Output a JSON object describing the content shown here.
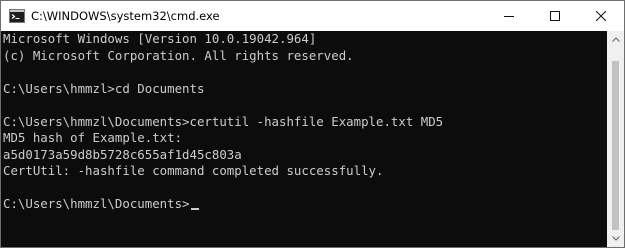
{
  "window": {
    "title": "C:\\WINDOWS\\system32\\cmd.exe",
    "icon": "cmd-app-icon"
  },
  "caption_buttons": {
    "minimize": "minimize-icon",
    "maximize": "maximize-icon",
    "close": "close-icon"
  },
  "console": {
    "lines": [
      "Microsoft Windows [Version 10.0.19042.964]",
      "(c) Microsoft Corporation. All rights reserved.",
      "",
      "C:\\Users\\hmmzl>cd Documents",
      "",
      "C:\\Users\\hmmzl\\Documents>certutil -hashfile Example.txt MD5",
      "MD5 hash of Example.txt:",
      "a5d0173a59d8b5728c655af1d45c803a",
      "CertUtil: -hashfile command completed successfully.",
      "",
      "C:\\Users\\hmmzl\\Documents>"
    ]
  },
  "scrollbar": {
    "thumb_fraction": 0.93,
    "position_fraction": 1.0
  },
  "colors": {
    "console_background": "#0c0c0c",
    "console_text": "#cccccc",
    "titlebar_background": "#ffffff"
  }
}
